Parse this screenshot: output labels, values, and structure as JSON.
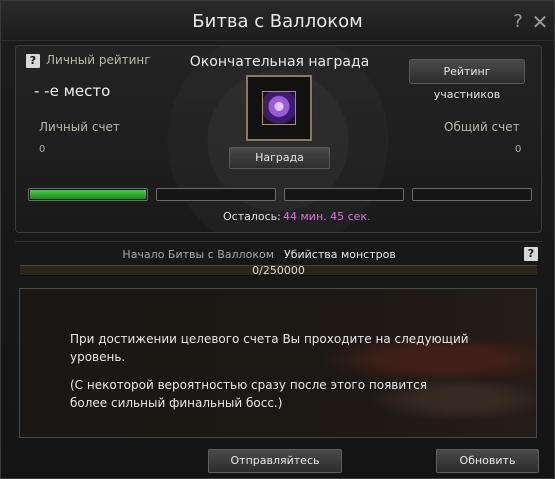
{
  "window": {
    "title": "Битва с Валлоком",
    "help_glyph": "?",
    "close_glyph": "✕"
  },
  "top_panel": {
    "personal_rating_label": "Личный рейтинг",
    "place_text": "- -е место",
    "final_reward_label": "Окончательная награда",
    "participants_rating_button": "Рейтинг участников",
    "reward_button": "Награда",
    "reward_item_icon": "purple-crystal-icon",
    "personal_score_label": "Личный счет",
    "total_score_label": "Общий счет",
    "personal_score_value": "0",
    "total_score_value": "0",
    "stages": [
      {
        "progress": 1.0,
        "color": "#3cb83c"
      },
      {
        "progress": 0.0
      },
      {
        "progress": 0.0
      },
      {
        "progress": 0.0
      }
    ],
    "remaining_label": "Осталось:",
    "remaining_time": "44 мин. 45 сек.",
    "remaining_time_color": "#e46ce4"
  },
  "progress_section": {
    "tab_start_label": "Начало Битвы с Валлоком",
    "tab_kills_label": "Убийства монстров",
    "progress_text": "0/250000",
    "progress_fraction": 0.0
  },
  "info": {
    "line1": "При достижении целевого счета Вы проходите на следующий",
    "line2": "уровень.",
    "line3": "(С некоторой вероятностью сразу после этого появится",
    "line4": "более сильный финальный босс.)"
  },
  "footer": {
    "go_button": "Отправляйтесь",
    "refresh_button": "Обновить"
  }
}
